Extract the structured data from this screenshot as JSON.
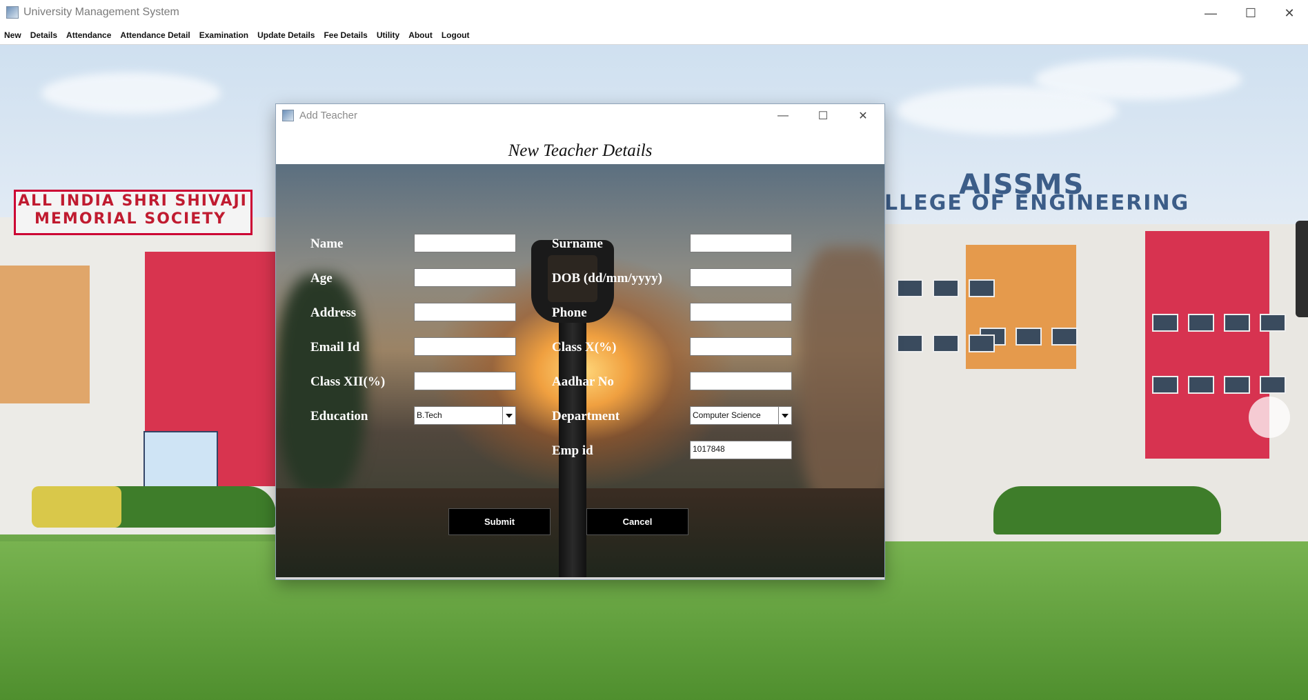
{
  "app": {
    "title": "University Management System",
    "controls": {
      "minimize": "—",
      "maximize": "☐",
      "close": "✕"
    }
  },
  "menu": [
    "New",
    "Details",
    "Attendance",
    "Attendance Detail",
    "Examination",
    "Update Details",
    "Fee Details",
    "Utility",
    "About",
    "Logout"
  ],
  "background": {
    "sign_left_1": "ALL INDIA SHRI SHIVAJI",
    "sign_left_2": "MEMORIAL SOCIETY",
    "sign_right_1": "AISSMS",
    "sign_right_2": "LLEGE OF ENGINEERING"
  },
  "dialog": {
    "title": "Add Teacher",
    "heading": "New Teacher Details",
    "controls": {
      "minimize": "—",
      "maximize": "☐",
      "close": "✕"
    },
    "labels": {
      "name": "Name",
      "surname": "Surname",
      "age": "Age",
      "dob": "DOB (dd/mm/yyyy)",
      "address": "Address",
      "phone": "Phone",
      "email": "Email Id",
      "class_x": "Class X(%)",
      "class_xii": "Class XII(%)",
      "aadhar": "Aadhar No",
      "education": "Education",
      "department": "Department",
      "emp_id": "Emp id"
    },
    "values": {
      "name": "",
      "surname": "",
      "age": "",
      "dob": "",
      "address": "",
      "phone": "",
      "email": "",
      "class_x": "",
      "class_xii": "",
      "aadhar": "",
      "education": "B.Tech",
      "department": "Computer Science",
      "emp_id": "1017848"
    },
    "buttons": {
      "submit": "Submit",
      "cancel": "Cancel"
    }
  }
}
